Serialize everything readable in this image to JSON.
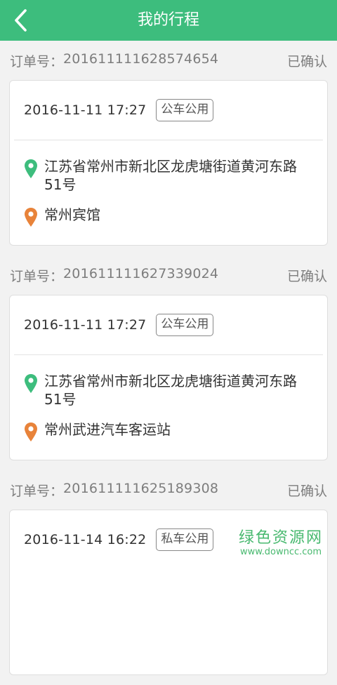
{
  "header": {
    "title": "我的行程"
  },
  "order_label": "订单号：",
  "orders": [
    {
      "order_no": "2016111116285746​54",
      "status": "已确认",
      "datetime": "2016-11-11 17:27",
      "tag": "公车公用",
      "from": "江苏省常州市新北区龙虎塘街道黄河东路51号",
      "to": "常州宾馆"
    },
    {
      "order_no": "201611111627339024",
      "status": "已确认",
      "datetime": "2016-11-11 17:27",
      "tag": "公车公用",
      "from": "江苏省常州市新北区龙虎塘街道黄河东路51号",
      "to": "常州武进汽车客运站"
    },
    {
      "order_no": "201611111625189308",
      "status": "已确认",
      "datetime": "2016-11-14 16:22",
      "tag": "私车公用",
      "from": "",
      "to": ""
    }
  ],
  "colors": {
    "header": "#3dbd7d",
    "pin_from": "#3dbd7d",
    "pin_to": "#e8833a"
  },
  "icons": {
    "back": "chevron-left-icon",
    "from": "map-pin-green-icon",
    "to": "map-pin-orange-icon"
  },
  "watermark": {
    "main": "绿色资源网",
    "url": "www.downcc.com"
  }
}
